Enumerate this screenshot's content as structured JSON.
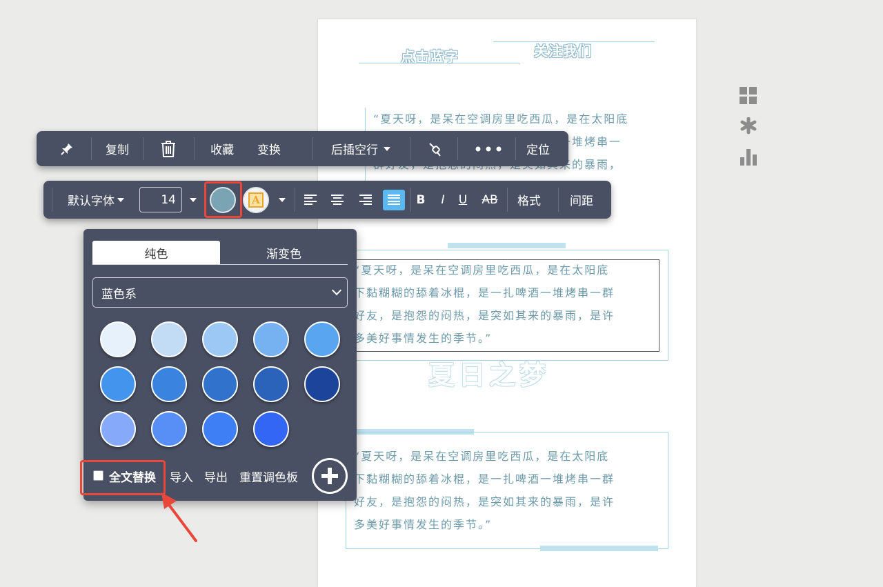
{
  "document": {
    "header_left": "点击蓝字",
    "header_right": "关注我们",
    "paragraph_1_lines": [
      "“夏天呀，是呆在空调房里吃西瓜，是在太阳底",
      "下黏糊糊的舔着冰棍，是一扎啤酒一堆烤串一",
      "群好友，是抱怨的闷热，是突如其来的暴雨，"
    ],
    "paragraph_2_lines": [
      "“夏天呀，是呆在空调房里吃西瓜，是在太阳底",
      "下黏糊糊的舔着冰棍，是一扎啤酒一堆烤串一群",
      "好友，是抱怨的闷热，是突如其来的暴雨，是许",
      "多美好事情发生的季节。”"
    ],
    "title": "夏日之梦",
    "paragraph_3_lines": [
      "“夏天呀，是呆在空调房里吃西瓜，是在太阳底",
      "下黏糊糊的舔着冰棍，是一扎啤酒一堆烤串一群",
      "好友，是抱怨的闷热，是突如其来的暴雨，是许",
      "多美好事情发生的季节。”"
    ]
  },
  "toolbar_top": {
    "pin_icon": "pin-icon",
    "copy": "复制",
    "delete_icon": "trash-icon",
    "favorite": "收藏",
    "transform": "变换",
    "insert_after": "后插空行",
    "brush_icon": "format-brush-icon",
    "more_icon": "more-dots-icon",
    "locate": "定位"
  },
  "toolbar_format": {
    "font": "默认字体",
    "font_size": "14",
    "text_color": "#7aa3b3",
    "bg_icon_letter": "A",
    "bold": "B",
    "italic": "I",
    "underline": "U",
    "strike": "AB",
    "format": "格式",
    "spacing": "间距"
  },
  "color_panel": {
    "tab_solid": "纯色",
    "tab_gradient": "渐变色",
    "palette_select": "蓝色系",
    "swatches": [
      "#e6f1fb",
      "#c3dcf6",
      "#9cc8f5",
      "#76b1f1",
      "#5aa5ef",
      "#4394ec",
      "#3a84df",
      "#3172cc",
      "#2b62ba",
      "#1c449a",
      "#86a9f9",
      "#588ff6",
      "#3e7ff6",
      "#3366f4"
    ],
    "replace_all": "全文替换",
    "import": "导入",
    "export": "导出",
    "reset_palette": "重置调色板"
  },
  "accent": {
    "highlight": "#e8473a",
    "active_align": "#5cb8f0"
  }
}
